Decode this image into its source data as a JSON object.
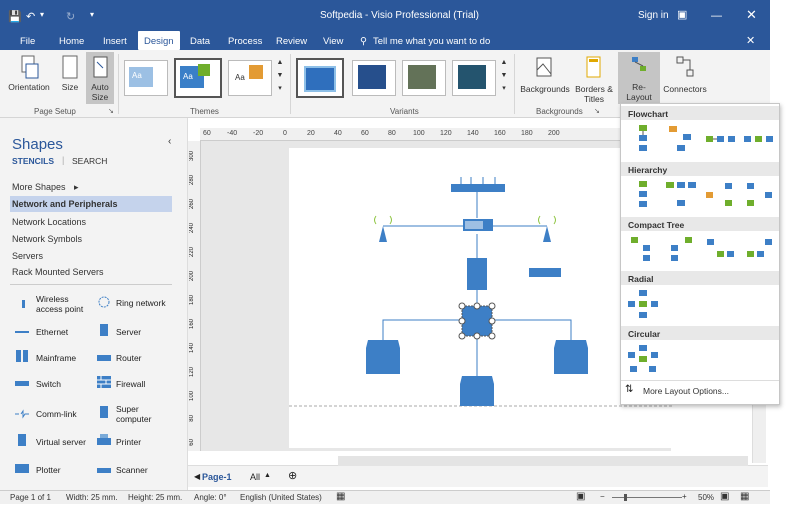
{
  "title_bar": {
    "title": "Softpedia - Visio Professional (Trial)",
    "sign_in": "Sign in"
  },
  "tabs": [
    {
      "label": "File"
    },
    {
      "label": "Home"
    },
    {
      "label": "Insert"
    },
    {
      "label": "Design"
    },
    {
      "label": "Data"
    },
    {
      "label": "Process"
    },
    {
      "label": "Review"
    },
    {
      "label": "View"
    }
  ],
  "tell_me": "Tell me what you want to do",
  "ribbon": {
    "orientation": "Orientation",
    "size": "Size",
    "auto_size": "Auto Size",
    "page_setup": "Page Setup",
    "themes": "Themes",
    "variants": "Variants",
    "backgrounds": "Backgrounds",
    "borders_titles": "Borders & Titles",
    "backgrounds_group": "Backgrounds",
    "relayout": "Re-Layout Page",
    "connectors": "Connectors",
    "theme_aa": "Aa"
  },
  "shapes_panel": {
    "title": "Shapes",
    "stencils": "STENCILS",
    "search": "SEARCH",
    "more_shapes": "More Shapes",
    "categories": [
      "Network and Peripherals",
      "Network Locations",
      "Network Symbols",
      "Servers",
      "Rack Mounted Servers"
    ],
    "items": [
      {
        "label": "Wireless access point",
        "icon": "wireless-access-point-icon"
      },
      {
        "label": "Ring network",
        "icon": "ring-network-icon"
      },
      {
        "label": "Ethernet",
        "icon": "ethernet-icon"
      },
      {
        "label": "Server",
        "icon": "server-icon"
      },
      {
        "label": "Mainframe",
        "icon": "mainframe-icon"
      },
      {
        "label": "Router",
        "icon": "router-icon"
      },
      {
        "label": "Switch",
        "icon": "switch-icon"
      },
      {
        "label": "Firewall",
        "icon": "firewall-icon"
      },
      {
        "label": "Comm-link",
        "icon": "comm-link-icon"
      },
      {
        "label": "Super computer",
        "icon": "super-computer-icon"
      },
      {
        "label": "Virtual server",
        "icon": "virtual-server-icon"
      },
      {
        "label": "Printer",
        "icon": "printer-icon"
      },
      {
        "label": "Plotter",
        "icon": "plotter-icon"
      },
      {
        "label": "Scanner",
        "icon": "scanner-icon"
      }
    ]
  },
  "ruler_ticks": [
    "60",
    "-40",
    "-20",
    "0",
    "20",
    "40",
    "60",
    "80",
    "100",
    "120",
    "140",
    "160",
    "180",
    "200"
  ],
  "ruler_left_ticks": [
    "300",
    "280",
    "260",
    "240",
    "220",
    "200",
    "180",
    "160",
    "140",
    "120",
    "100",
    "80",
    "60"
  ],
  "page_tabs": {
    "page1": "Page-1",
    "all": "All"
  },
  "status_bar": {
    "page": "Page 1 of 1",
    "width": "Width: 25 mm.",
    "height": "Height: 25 mm.",
    "angle": "Angle: 0°",
    "language": "English (United States)",
    "zoom": "50%"
  },
  "relayout_panel": {
    "sections": [
      "Flowchart",
      "Hierarchy",
      "Compact Tree",
      "Radial",
      "Circular"
    ],
    "more_options": "More Layout Options..."
  },
  "colors": {
    "accent": "#2b579a",
    "shape_blue": "#3d7fc6",
    "selected_category": "#c5d3ec"
  }
}
